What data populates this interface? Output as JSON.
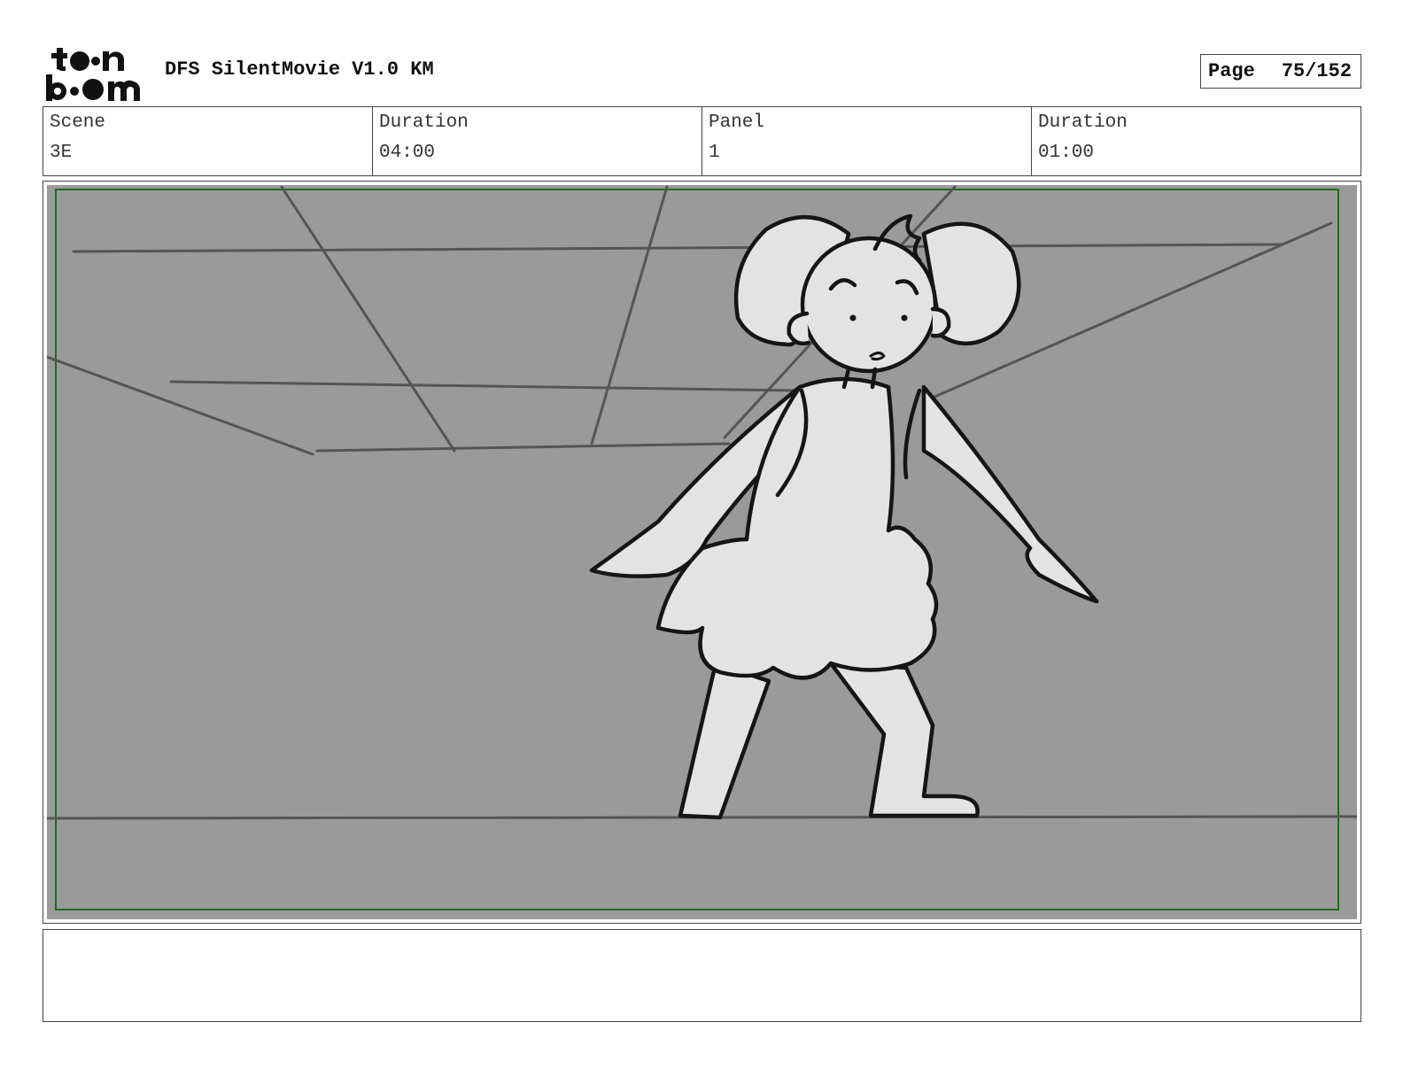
{
  "header": {
    "logo_text": "toon boom",
    "project_title": "DFS SilentMovie V1.0 KM",
    "page_label": "Page",
    "page_number": "75/152"
  },
  "info": {
    "scene_label": "Scene",
    "scene_value": "3E",
    "scene_duration_label": "Duration",
    "scene_duration_value": "04:00",
    "panel_label": "Panel",
    "panel_value": "1",
    "panel_duration_label": "Duration",
    "panel_duration_value": "01:00"
  },
  "panel": {
    "background_color": "#9a9a9a",
    "safe_frame_color": "#1f6b1f",
    "figure_fill": "#e3e3e3"
  },
  "notes": {
    "text": ""
  }
}
